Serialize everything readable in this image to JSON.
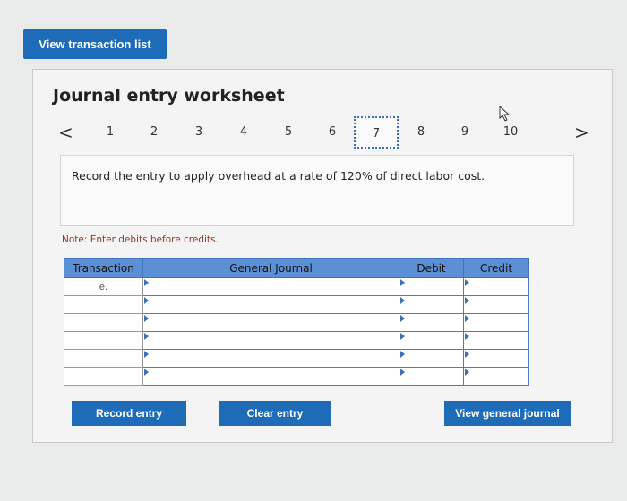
{
  "top_button": "View transaction list",
  "worksheet": {
    "title": "Journal entry worksheet",
    "pager": {
      "prev": "<",
      "next": ">",
      "pages": [
        "1",
        "2",
        "3",
        "4",
        "5",
        "6",
        "7",
        "8",
        "9",
        "10"
      ],
      "active": "7"
    },
    "prompt": "Record the entry to apply overhead at a rate of 120% of direct labor cost.",
    "note": "Note: Enter debits before credits.",
    "table": {
      "headers": [
        "Transaction",
        "General Journal",
        "Debit",
        "Credit"
      ],
      "rows": [
        {
          "transaction": "e.",
          "account": "",
          "debit": "",
          "credit": ""
        },
        {
          "transaction": "",
          "account": "",
          "debit": "",
          "credit": ""
        },
        {
          "transaction": "",
          "account": "",
          "debit": "",
          "credit": ""
        },
        {
          "transaction": "",
          "account": "",
          "debit": "",
          "credit": ""
        },
        {
          "transaction": "",
          "account": "",
          "debit": "",
          "credit": ""
        },
        {
          "transaction": "",
          "account": "",
          "debit": "",
          "credit": ""
        }
      ]
    },
    "buttons": {
      "record": "Record entry",
      "clear": "Clear entry",
      "view_journal": "View general journal"
    }
  },
  "colors": {
    "primary_button": "#1e6bb8",
    "table_header": "#5b8fd6",
    "note_text": "#8a3b2a"
  }
}
